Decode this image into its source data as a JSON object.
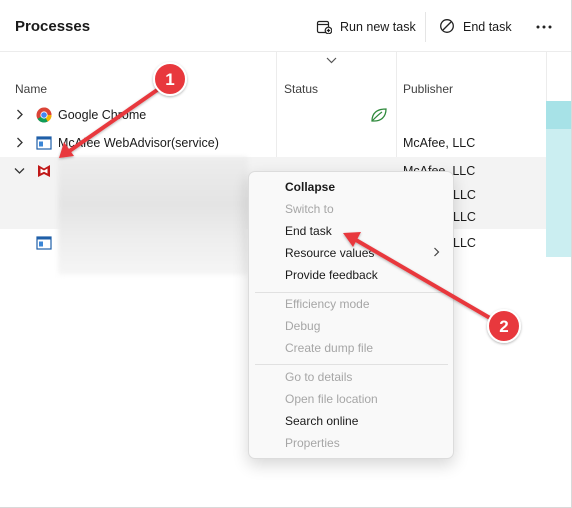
{
  "header": {
    "title": "Processes",
    "run_new_task": "Run new task",
    "end_task": "End task",
    "more": "•••"
  },
  "columns": {
    "name": "Name",
    "status": "Status",
    "publisher": "Publisher"
  },
  "rows": [
    {
      "name": "Google Chrome",
      "publisher": "",
      "icon": "chrome-icon",
      "expanded": false
    },
    {
      "name": "McAfee WebAdvisor(service)",
      "publisher": "McAfee, LLC",
      "icon": "app-window-icon",
      "expanded": false
    },
    {
      "name": "",
      "publisher": "McAfee, LLC",
      "icon": "mcafee-icon",
      "expanded": true
    },
    {
      "name": "",
      "publisher": "LLC",
      "icon": "app-window-icon",
      "expanded": false
    }
  ],
  "group_publishers": [
    "LLC",
    "LLC"
  ],
  "context_menu": {
    "items": [
      {
        "label": "Collapse",
        "enabled": true,
        "bold": true
      },
      {
        "label": "Switch to",
        "enabled": false
      },
      {
        "label": "End task",
        "enabled": true
      },
      {
        "label": "Resource values",
        "enabled": true,
        "submenu": true
      },
      {
        "label": "Provide feedback",
        "enabled": true
      },
      {
        "label": "Efficiency mode",
        "enabled": false
      },
      {
        "label": "Debug",
        "enabled": false
      },
      {
        "label": "Create dump file",
        "enabled": false
      },
      {
        "label": "Go to details",
        "enabled": false
      },
      {
        "label": "Open file location",
        "enabled": false
      },
      {
        "label": "Search online",
        "enabled": true
      },
      {
        "label": "Properties",
        "enabled": false
      }
    ]
  },
  "annotations": [
    {
      "number": "1",
      "color": "#e8383d"
    },
    {
      "number": "2",
      "color": "#e8383d"
    }
  ],
  "colors": {
    "accent_teal": "#cbeef1",
    "annotation_red": "#e8383d",
    "eco_green": "#2f8a3c",
    "mcafee_red": "#c01818"
  }
}
